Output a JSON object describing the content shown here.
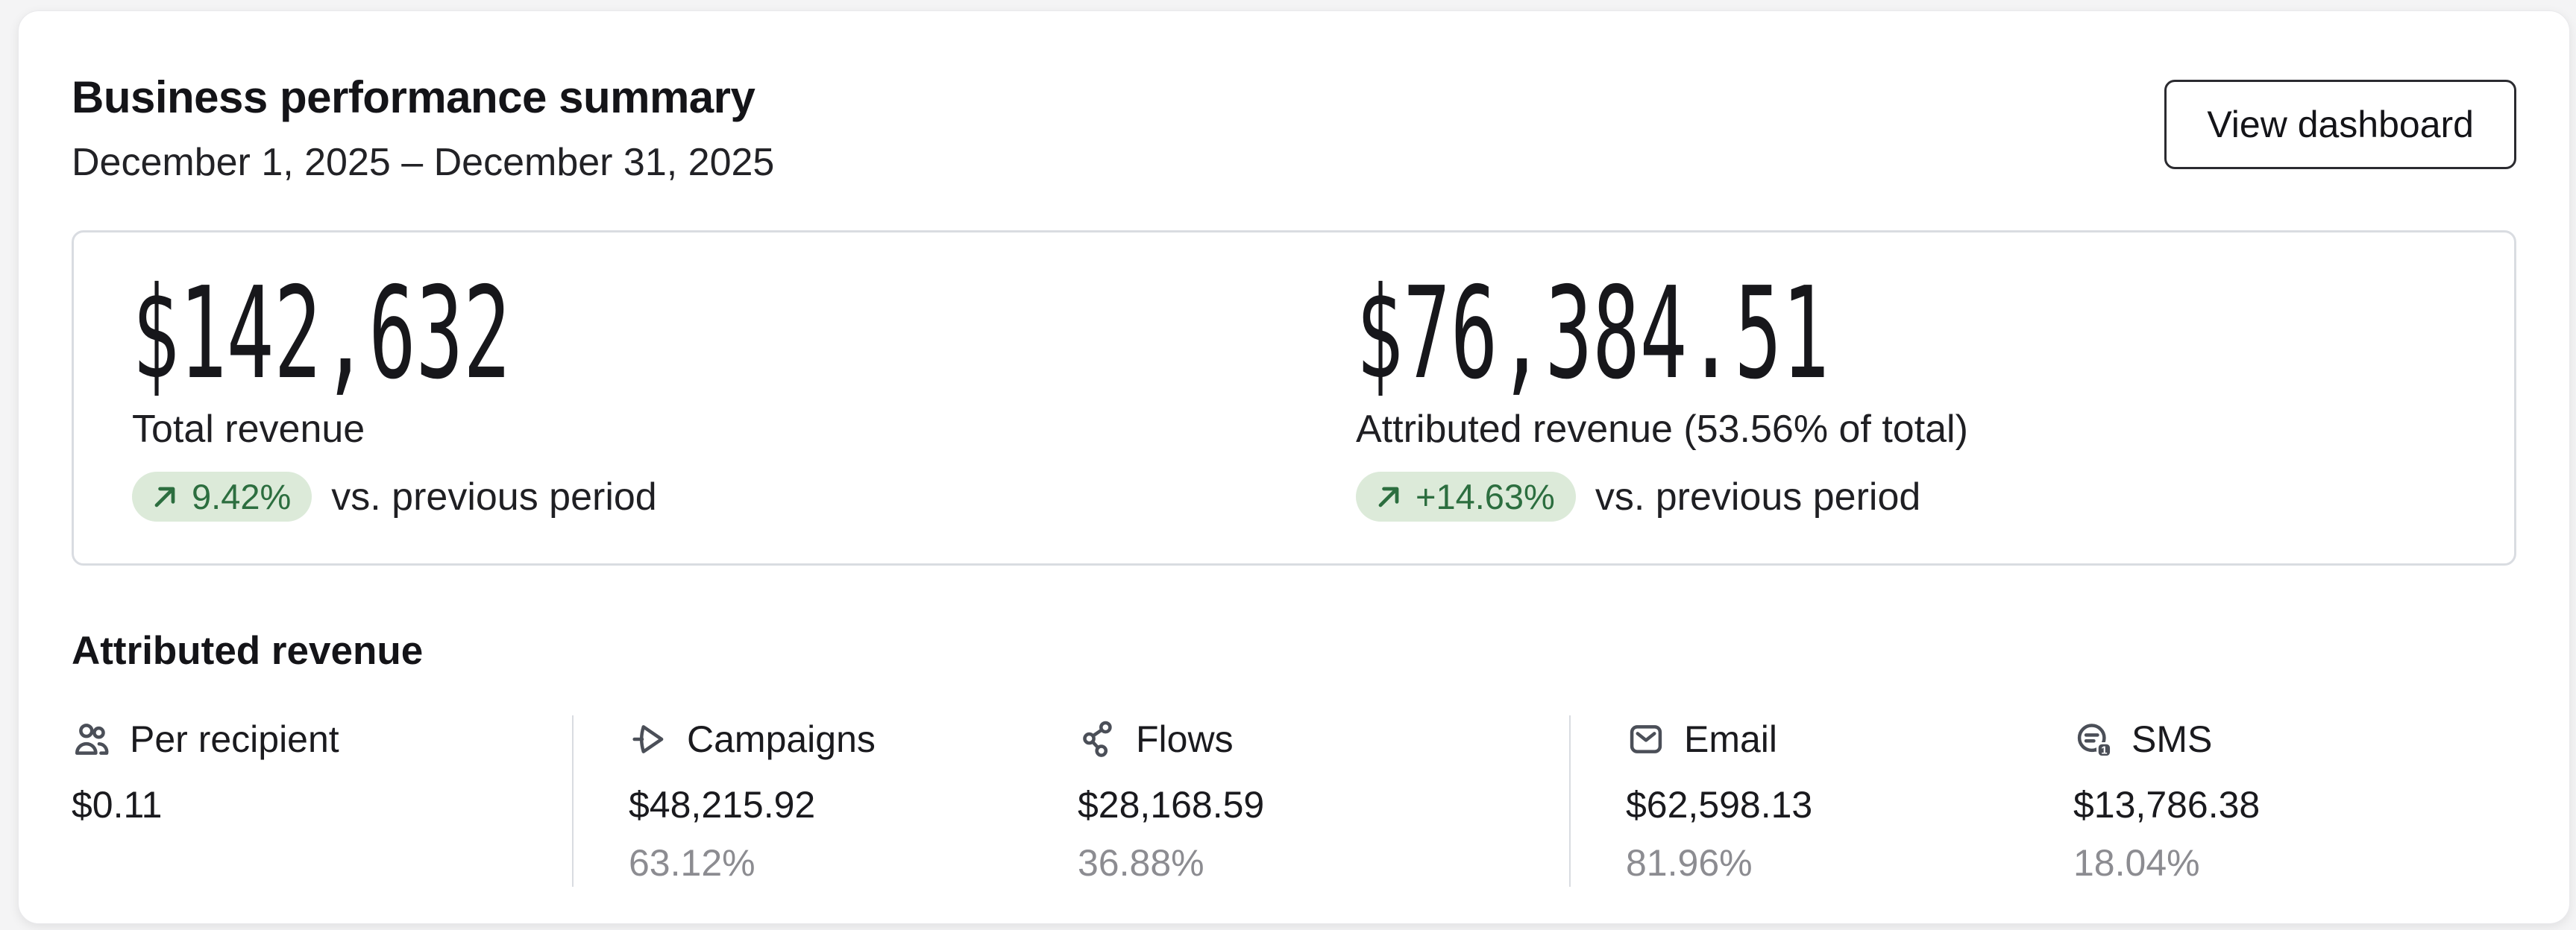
{
  "colors": {
    "page-bg": "#f4f4f5",
    "card-bg": "#ffffff",
    "text-dark": "#1b1b1f",
    "text-gray": "#8c8c91",
    "icon-gray": "#4b4f58",
    "border-light": "#d9dce1",
    "badge-bg": "#dcead9",
    "badge-green": "#2c6e3f"
  },
  "header": {
    "title": "Business performance summary",
    "date_range": "December 1, 2025 – December 31, 2025",
    "view_dashboard_label": "View dashboard"
  },
  "summary_stats": {
    "total_revenue": {
      "value": "$142,632",
      "label": "Total revenue",
      "change": "9.42%",
      "comparison": "vs. previous period"
    },
    "attributed_revenue": {
      "value": "$76,384.51",
      "label": "Attributed revenue (53.56% of total)",
      "change": "+14.63%",
      "comparison": "vs. previous period"
    }
  },
  "attributed_section": {
    "heading": "Attributed revenue",
    "sms_icon_badge": "1",
    "metrics": [
      {
        "icon": "users-icon",
        "name": "Per recipient",
        "value": "$0.11",
        "percent": ""
      },
      {
        "icon": "send-icon",
        "name": "Campaigns",
        "value": "$48,215.92",
        "percent": "63.12%"
      },
      {
        "icon": "flow-icon",
        "name": "Flows",
        "value": "$28,168.59",
        "percent": "36.88%"
      },
      {
        "icon": "email-icon",
        "name": "Email",
        "value": "$62,598.13",
        "percent": "81.96%"
      },
      {
        "icon": "sms-icon",
        "name": "SMS",
        "value": "$13,786.38",
        "percent": "18.04%"
      }
    ]
  }
}
